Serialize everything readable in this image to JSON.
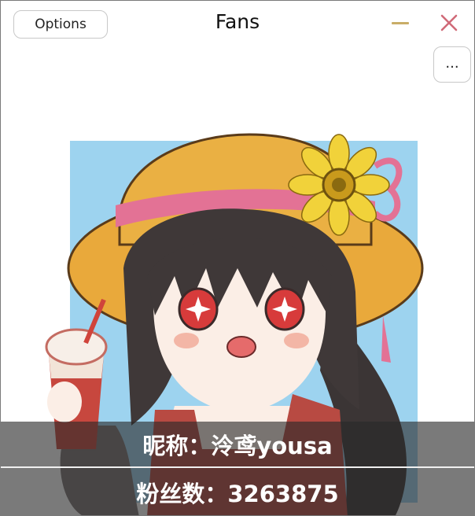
{
  "window": {
    "title": "Fans",
    "options_label": "Options",
    "more_label": "...",
    "accent_minimize": "#c9ad67",
    "accent_close": "#d06a78"
  },
  "profile": {
    "nickname_line": "昵称：泠鸢yousa",
    "fans_line": "粉丝数：3263875"
  },
  "icons": [
    "minimize-icon",
    "close-icon"
  ]
}
